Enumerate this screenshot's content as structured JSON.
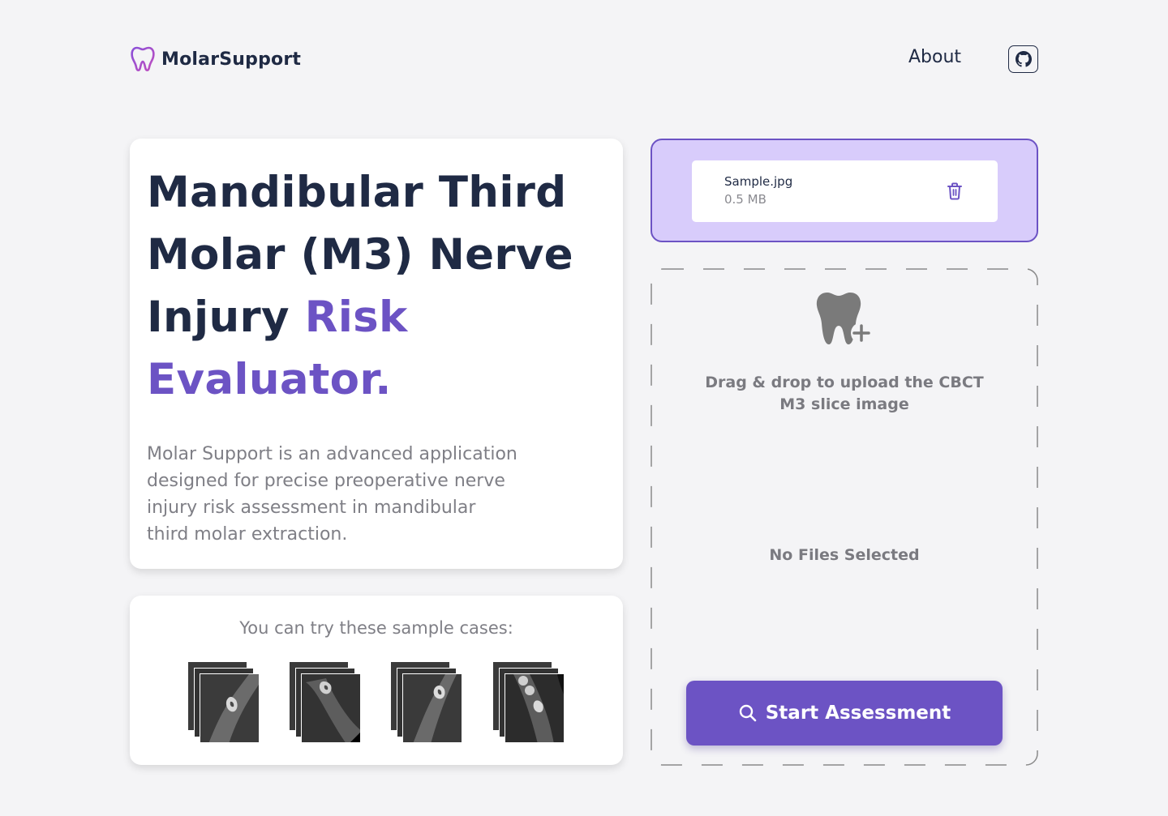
{
  "header": {
    "brand_name": "MolarSupport",
    "nav": {
      "about_label": "About"
    },
    "github_icon": "github-icon"
  },
  "hero": {
    "title_main": "Mandibular Third Molar (M3) Nerve Injury ",
    "title_accent": "Risk Evaluator.",
    "description": "Molar Support is an advanced application designed for precise preoperative nerve injury risk assessment in mandibular third molar extraction."
  },
  "samples": {
    "title": "You can try these sample cases:",
    "items": [
      {
        "name": "sample-case-1"
      },
      {
        "name": "sample-case-2"
      },
      {
        "name": "sample-case-3"
      },
      {
        "name": "sample-case-4"
      }
    ]
  },
  "upload": {
    "file_name": "Sample.jpg",
    "file_size": "0.5 MB",
    "delete_icon": "trash-icon",
    "drop_icon": "tooth-plus-icon",
    "drop_text": "Drag & drop to upload the CBCT M3 slice image",
    "no_files_text": "No Files Selected",
    "start_label": "Start Assessment",
    "start_icon": "search-icon"
  },
  "colors": {
    "accent": "#6c53c4",
    "accent_light": "#d8ccfb",
    "text_dark": "#1f2a44",
    "text_muted": "#7f7f86",
    "background": "#f4f4f6"
  }
}
